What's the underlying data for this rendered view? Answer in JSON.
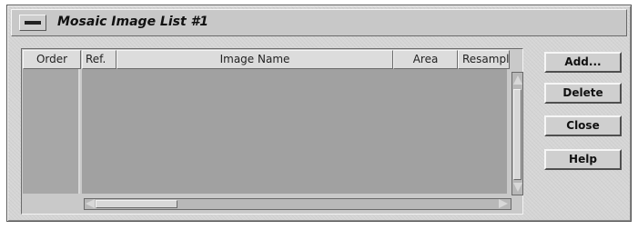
{
  "window": {
    "title": "Mosaic Image List #1"
  },
  "list": {
    "columns": {
      "order": "Order",
      "ref": "Ref.",
      "image_name": "Image Name",
      "area": "Area",
      "resample": "Resampl"
    },
    "rows": []
  },
  "buttons": {
    "add": "Add...",
    "delete": "Delete",
    "close": "Close",
    "help": "Help"
  },
  "icons": {
    "window_menu": "window-menu-icon",
    "up_arrow": "up-arrow-icon",
    "down_arrow": "down-arrow-icon",
    "left_arrow": "left-arrow-icon",
    "right_arrow": "right-arrow-icon"
  }
}
